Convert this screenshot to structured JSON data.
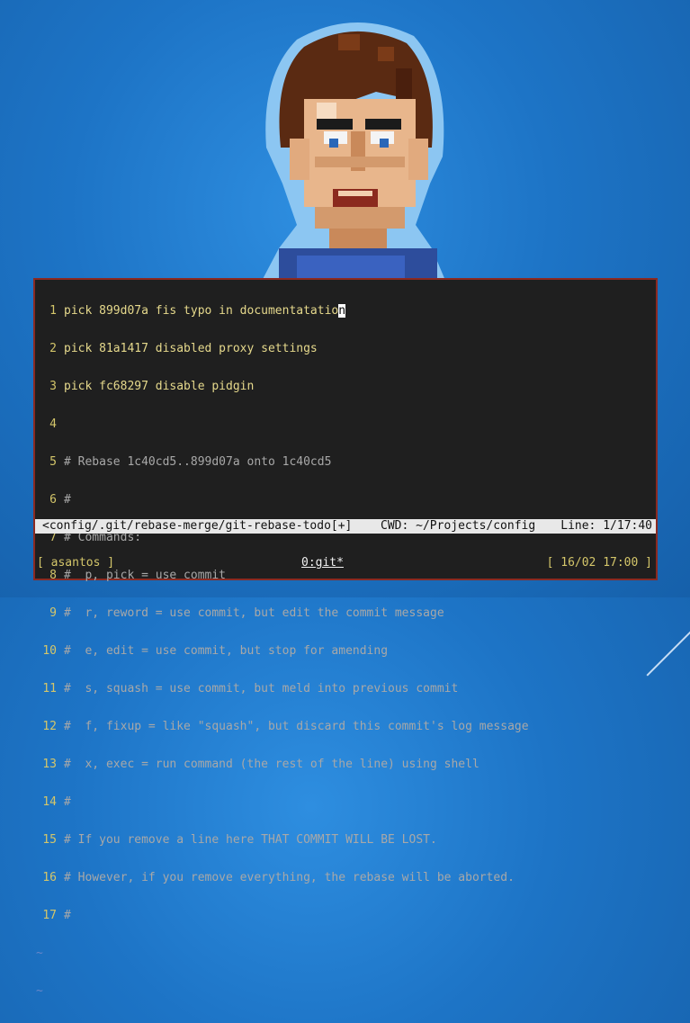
{
  "editor": {
    "lines": [
      {
        "num": "1",
        "text": "pick 899d07a fis typo in documentatatio",
        "cursor_char": "n",
        "kind": "pick"
      },
      {
        "num": "2",
        "text": "pick 81a1417 disabled proxy settings",
        "kind": "pick"
      },
      {
        "num": "3",
        "text": "pick fc68297 disable pidgin",
        "kind": "pick"
      },
      {
        "num": "4",
        "text": "",
        "kind": "cmt"
      },
      {
        "num": "5",
        "text": "# Rebase 1c40cd5..899d07a onto 1c40cd5",
        "kind": "cmt"
      },
      {
        "num": "6",
        "text": "#",
        "kind": "cmt"
      },
      {
        "num": "7",
        "text": "# Commands:",
        "kind": "cmt"
      },
      {
        "num": "8",
        "text": "#  p, pick = use commit",
        "kind": "cmt"
      },
      {
        "num": "9",
        "text": "#  r, reword = use commit, but edit the commit message",
        "kind": "cmt"
      },
      {
        "num": "10",
        "text": "#  e, edit = use commit, but stop for amending",
        "kind": "cmt"
      },
      {
        "num": "11",
        "text": "#  s, squash = use commit, but meld into previous commit",
        "kind": "cmt"
      },
      {
        "num": "12",
        "text": "#  f, fixup = like \"squash\", but discard this commit's log message",
        "kind": "cmt"
      },
      {
        "num": "13",
        "text": "#  x, exec = run command (the rest of the line) using shell",
        "kind": "cmt"
      },
      {
        "num": "14",
        "text": "#",
        "kind": "cmt"
      },
      {
        "num": "15",
        "text": "# If you remove a line here THAT COMMIT WILL BE LOST.",
        "kind": "cmt"
      },
      {
        "num": "16",
        "text": "# However, if you remove everything, the rebase will be aborted.",
        "kind": "cmt"
      },
      {
        "num": "17",
        "text": "#",
        "kind": "cmt"
      }
    ],
    "tildes": [
      "~",
      "~"
    ]
  },
  "statusline": {
    "file": "<config/.git/rebase-merge/git-rebase-todo[+]",
    "cwd": "CWD: ~/Projects/config",
    "position": "Line: 1/17:40"
  },
  "tmux": {
    "session": "[ asantos ]",
    "window": "0:git*",
    "datetime": "[ 16/02 17:00 ]"
  },
  "colors": {
    "desktop_bg": "#1d74c6",
    "terminal_bg": "#1f1f1f",
    "terminal_border": "#8b2a22",
    "line_number": "#d4c66a",
    "pick_text": "#e6d98c",
    "comment_text": "#a8a8a8",
    "statusline_bg": "#e8e8e8"
  },
  "icons": {
    "avatar": "pixel-art-portrait"
  }
}
